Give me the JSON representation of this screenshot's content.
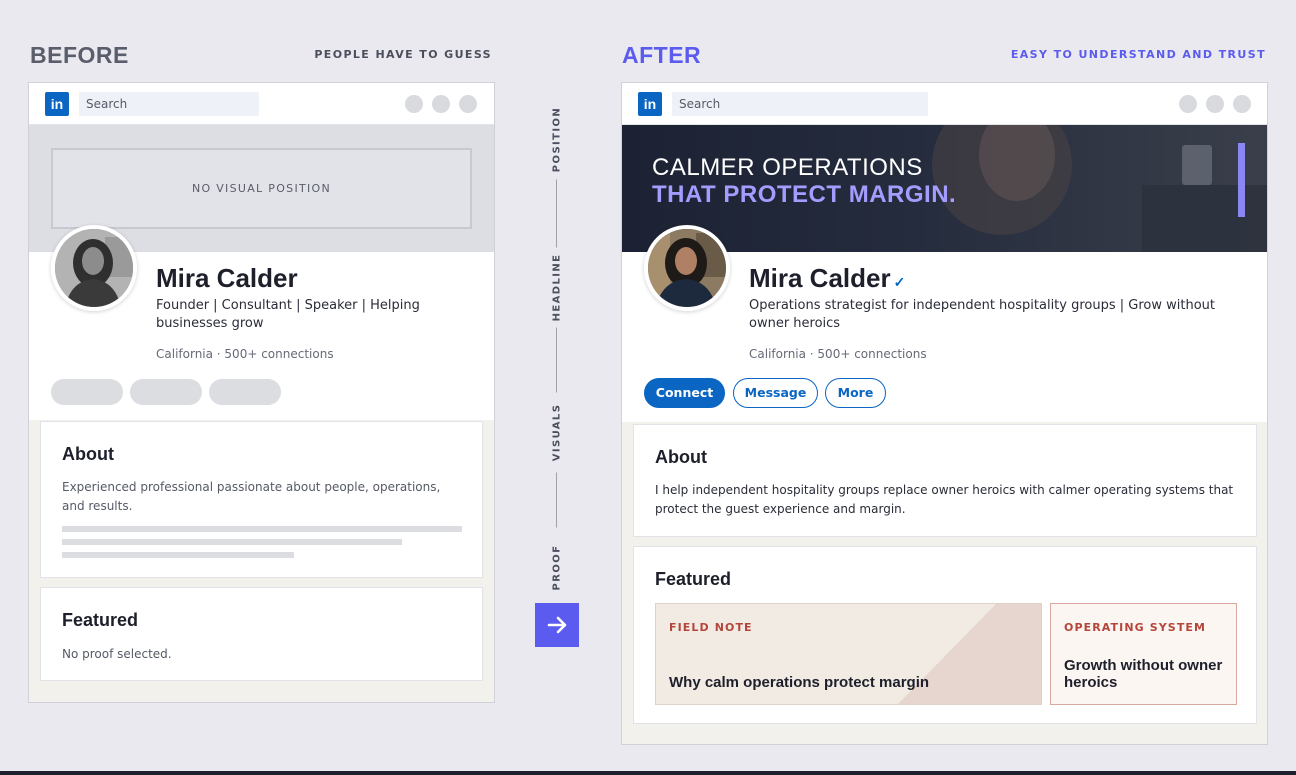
{
  "before": {
    "title": "BEFORE",
    "subtitle": "PEOPLE HAVE TO GUESS",
    "search_placeholder": "Search",
    "banner_text": "NO VISUAL POSITION",
    "name": "Mira Calder",
    "headline": "Founder | Consultant | Speaker | Helping businesses grow",
    "location": "California · 500+ connections",
    "about": {
      "heading": "About",
      "text": "Experienced professional passionate about people, operations, and results."
    },
    "featured": {
      "heading": "Featured",
      "text": "No proof selected."
    }
  },
  "after": {
    "title": "AFTER",
    "subtitle": "EASY TO UNDERSTAND AND TRUST",
    "search_placeholder": "Search",
    "banner_line1": "CALMER OPERATIONS",
    "banner_line2": "THAT PROTECT MARGIN.",
    "name": "Mira Calder",
    "verified_mark": "✓",
    "headline": "Operations strategist for independent hospitality groups | Grow without owner heroics",
    "location": "California · 500+ connections",
    "buttons": {
      "connect": "Connect",
      "message": "Message",
      "more": "More"
    },
    "about": {
      "heading": "About",
      "text": "I help independent hospitality groups replace owner heroics with calmer operating systems that protect the guest experience and margin."
    },
    "featured": {
      "heading": "Featured",
      "items": [
        {
          "tag": "FIELD NOTE",
          "title": "Why calm operations protect margin"
        },
        {
          "tag": "OPERATING SYSTEM",
          "title": "Growth without owner heroics"
        }
      ]
    }
  },
  "steps": [
    "POSITION",
    "HEADLINE",
    "VISUALS",
    "PROOF"
  ],
  "arrow_icon": "arrow-right-icon",
  "colors": {
    "accent": "#5b5bf0",
    "linkedin_blue": "#0a66c2",
    "banner_dark": "#1f2638",
    "banner_highlight": "#a49cff",
    "tag_red": "#b5453a",
    "before_title": "#5a5d6b"
  }
}
